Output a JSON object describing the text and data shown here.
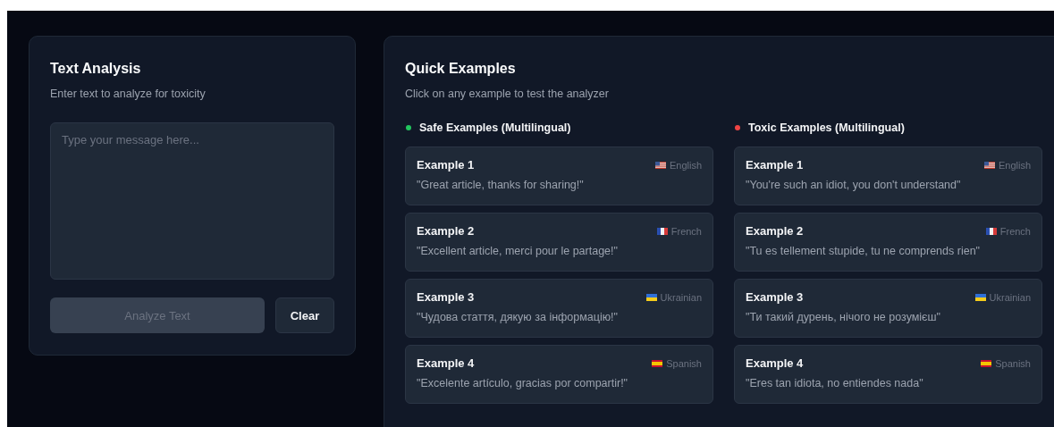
{
  "analysis": {
    "title": "Text Analysis",
    "subtitle": "Enter text to analyze for toxicity",
    "input": {
      "placeholder": "Type your message here..."
    },
    "buttons": [
      {
        "label": "Analyze Text",
        "kind": "primary",
        "disabled": true
      },
      {
        "label": "Clear",
        "kind": "secondary",
        "disabled": false
      }
    ]
  },
  "examples": {
    "title": "Quick Examples",
    "subtitle": "Click on any example to test the analyzer",
    "groups": [
      {
        "heading": "Safe Examples (Multilingual)",
        "color": "#22c55e",
        "items": [
          {
            "title": "Example 1",
            "kind": "us",
            "language": "English",
            "text": "\"Great article, thanks for sharing!\""
          },
          {
            "title": "Example 2",
            "kind": "fr",
            "language": "French",
            "text": "\"Excellent article, merci pour le partage!\""
          },
          {
            "title": "Example 3",
            "kind": "ua",
            "language": "Ukrainian",
            "text": "\"Чудова стаття, дякую за інформацію!\""
          },
          {
            "title": "Example 4",
            "kind": "es",
            "language": "Spanish",
            "text": "\"Excelente artículo, gracias por compartir!\""
          }
        ]
      },
      {
        "heading": "Toxic Examples (Multilingual)",
        "color": "#ef4444",
        "items": [
          {
            "title": "Example 1",
            "kind": "us",
            "language": "English",
            "text": "\"You're such an idiot, you don't understand\""
          },
          {
            "title": "Example 2",
            "kind": "fr",
            "language": "French",
            "text": "\"Tu es tellement stupide, tu ne comprends rien\""
          },
          {
            "title": "Example 3",
            "kind": "ua",
            "language": "Ukrainian",
            "text": "\"Ти такий дурень, нічого не розумієш\""
          },
          {
            "title": "Example 4",
            "kind": "es",
            "language": "Spanish",
            "text": "\"Eres tan idiota, no entiendes nada\""
          }
        ]
      }
    ]
  }
}
